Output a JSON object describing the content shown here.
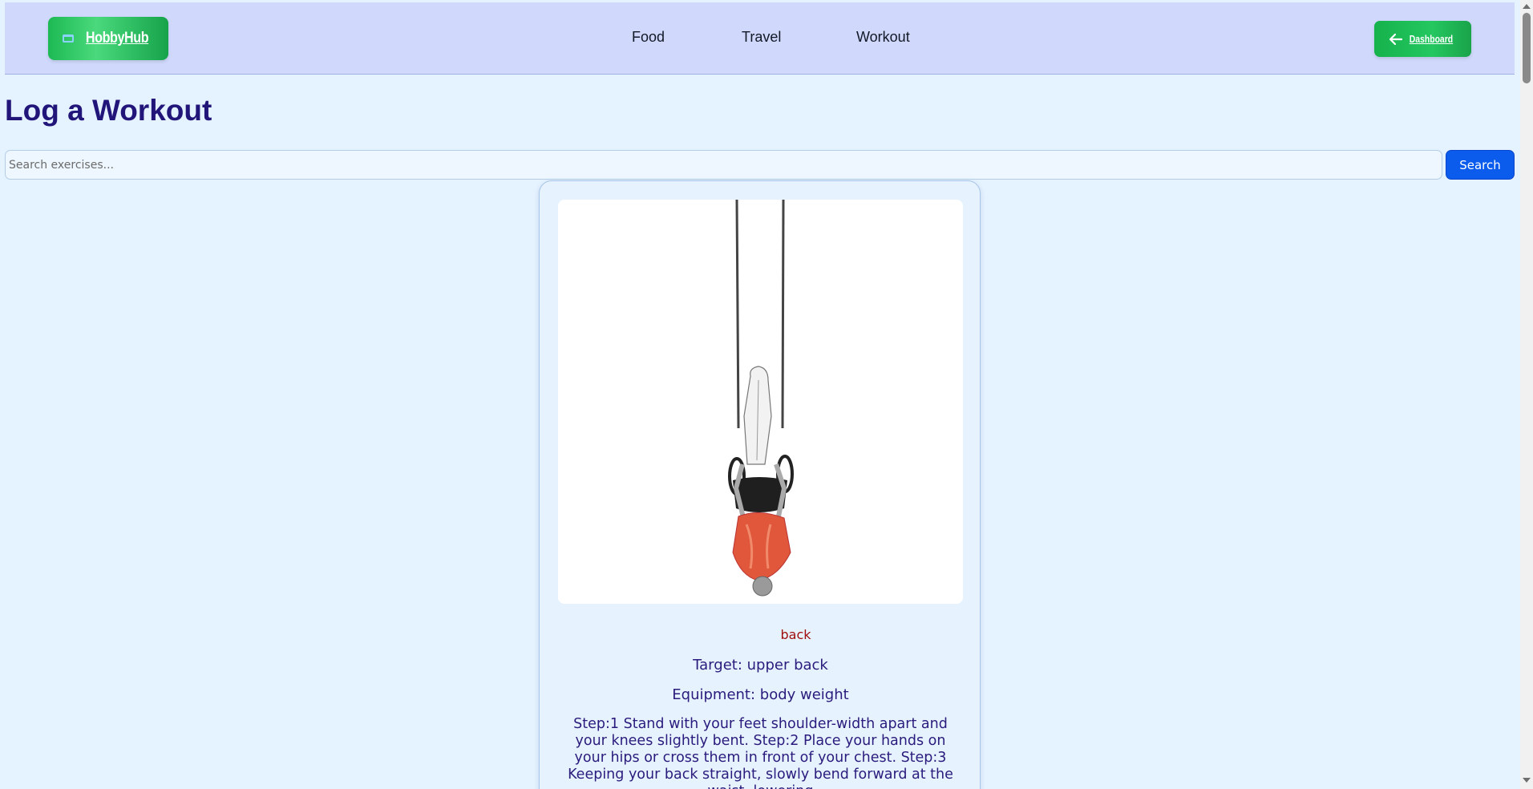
{
  "header": {
    "brand": "HobbyHub",
    "nav": [
      {
        "label": "Food"
      },
      {
        "label": "Travel"
      },
      {
        "label": "Workout"
      }
    ],
    "dashboard_label": "Dashboard"
  },
  "main": {
    "title": "Log a Workout",
    "search": {
      "placeholder": "Search exercises...",
      "value": "",
      "button_label": "Search"
    },
    "exercise": {
      "body_part": "back",
      "target": "Target: upper back",
      "equipment": "Equipment: body weight",
      "instructions": "Step:1 Stand with your feet shoulder-width apart and your knees slightly bent. Step:2 Place your hands on your hips or cross them in front of your chest. Step:3 Keeping your back straight, slowly bend forward at the waist, lowering"
    }
  },
  "colors": {
    "header_bg": "#d0d9fc",
    "page_bg": "#e5f2ff",
    "accent_green": "#1db954",
    "search_blue": "#0b5bed",
    "title_color": "#22157a"
  }
}
